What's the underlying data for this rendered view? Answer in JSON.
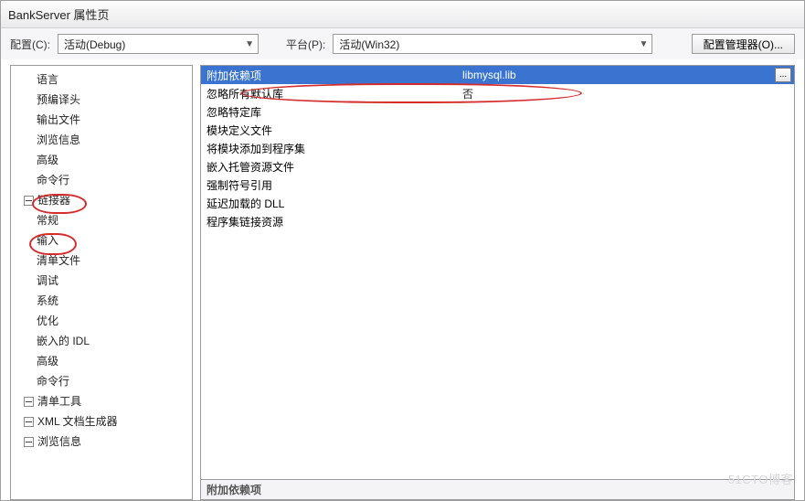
{
  "window": {
    "title": "BankServer 属性页"
  },
  "toolbar": {
    "config_label": "配置(C):",
    "config_value": "活动(Debug)",
    "platform_label": "平台(P):",
    "platform_value": "活动(Win32)",
    "configmgr_label": "配置管理器(O)..."
  },
  "tree": {
    "items": [
      {
        "level": 1,
        "label": "语言"
      },
      {
        "level": 1,
        "label": "预编译头"
      },
      {
        "level": 1,
        "label": "输出文件"
      },
      {
        "level": 1,
        "label": "浏览信息"
      },
      {
        "level": 1,
        "label": "高级"
      },
      {
        "level": 1,
        "label": "命令行"
      },
      {
        "level": 0,
        "label": "链接器",
        "circle": "linker",
        "expand": true
      },
      {
        "level": 1,
        "label": "常规"
      },
      {
        "level": 1,
        "label": "输入",
        "circle": "input"
      },
      {
        "level": 1,
        "label": "清单文件"
      },
      {
        "level": 1,
        "label": "调试"
      },
      {
        "level": 1,
        "label": "系统"
      },
      {
        "level": 1,
        "label": "优化"
      },
      {
        "level": 1,
        "label": "嵌入的 IDL"
      },
      {
        "level": 1,
        "label": "高级"
      },
      {
        "level": 1,
        "label": "命令行"
      },
      {
        "level": 0,
        "label": "清单工具",
        "expand": true
      },
      {
        "level": 0,
        "label": "XML 文档生成器",
        "expand": true
      },
      {
        "level": 0,
        "label": "浏览信息",
        "expand": true
      }
    ]
  },
  "grid": {
    "rows": [
      {
        "name": "附加依赖项",
        "value": "libmysql.lib",
        "selected": true
      },
      {
        "name": "忽略所有默认库",
        "value": "否"
      },
      {
        "name": "忽略特定库",
        "value": ""
      },
      {
        "name": "模块定义文件",
        "value": ""
      },
      {
        "name": "将模块添加到程序集",
        "value": ""
      },
      {
        "name": "嵌入托管资源文件",
        "value": ""
      },
      {
        "name": "强制符号引用",
        "value": ""
      },
      {
        "name": "延迟加载的 DLL",
        "value": ""
      },
      {
        "name": "程序集链接资源",
        "value": ""
      }
    ],
    "desc_title": "附加依赖项"
  },
  "ellipsis": "...",
  "watermark": "51CTO博客"
}
